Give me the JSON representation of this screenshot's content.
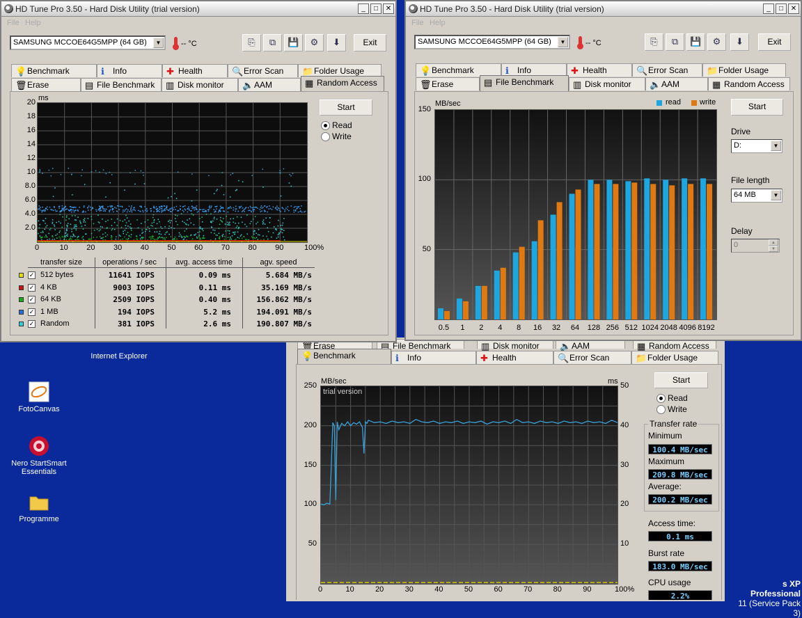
{
  "app_title": "HD Tune Pro 3.50 - Hard Disk Utility (trial version)",
  "menu": [
    "File",
    "Help"
  ],
  "drive": "SAMSUNG MCCOE64G5MPP (64 GB)",
  "temperature": "-- °C",
  "exit_label": "Exit",
  "start_label": "Start",
  "read_label": "Read",
  "write_label": "Write",
  "tabs_row1": [
    "Benchmark",
    "Info",
    "Health",
    "Error Scan",
    "Folder Usage"
  ],
  "tabs_row2": [
    "Erase",
    "File Benchmark",
    "Disk monitor",
    "AAM",
    "Random Access"
  ],
  "random_access": {
    "y_unit": "ms",
    "y_ticks": [
      "20",
      "18",
      "16",
      "14",
      "12",
      "10",
      "8.0",
      "6.0",
      "4.0",
      "2.0"
    ],
    "x_ticks": [
      "0",
      "10",
      "20",
      "30",
      "40",
      "50",
      "60",
      "70",
      "80",
      "90",
      "100%"
    ],
    "headers": [
      "transfer size",
      "operations / sec",
      "avg. access time",
      "agv. speed"
    ],
    "rows": [
      {
        "size": "512 bytes",
        "ops": "11641 IOPS",
        "time": "0.09 ms",
        "speed": "5.684 MB/s",
        "color": "#e8e000"
      },
      {
        "size": "4 KB",
        "ops": "9003 IOPS",
        "time": "0.11 ms",
        "speed": "35.169 MB/s",
        "color": "#cc1010"
      },
      {
        "size": "64 KB",
        "ops": "2509 IOPS",
        "time": "0.40 ms",
        "speed": "156.862 MB/s",
        "color": "#10b010"
      },
      {
        "size": "1 MB",
        "ops": "194 IOPS",
        "time": "5.2 ms",
        "speed": "194.091 MB/s",
        "color": "#2070e0"
      },
      {
        "size": "Random",
        "ops": "381 IOPS",
        "time": "2.6 ms",
        "speed": "190.807 MB/s",
        "color": "#30d0e0"
      }
    ]
  },
  "file_benchmark": {
    "y_unit": "MB/sec",
    "legend": {
      "read": "read",
      "write": "write"
    },
    "drive_label": "Drive",
    "drive_value": "D:",
    "file_length_label": "File length",
    "file_length_value": "64 MB",
    "delay_label": "Delay",
    "delay_value": "0"
  },
  "benchmark": {
    "y_unit_left": "MB/sec",
    "y_unit_right": "ms",
    "watermark": "trial version",
    "transfer_rate_label": "Transfer rate",
    "minimum_label": "Minimum",
    "minimum_value": "100.4 MB/sec",
    "maximum_label": "Maximum",
    "maximum_value": "209.8 MB/sec",
    "average_label": "Average:",
    "average_value": "200.2 MB/sec",
    "access_label": "Access time:",
    "access_value": "0.1 ms",
    "burst_label": "Burst rate",
    "burst_value": "183.0 MB/sec",
    "cpu_label": "CPU usage",
    "cpu_value": "2.2%"
  },
  "desktop_icons": [
    "Internet Explorer",
    "FotoCanvas",
    "Nero StartSmart Essentials",
    "Programme"
  ],
  "taskbar_text": [
    "s XP Professional",
    "11 (Service Pack 3)"
  ],
  "chart_data": [
    {
      "type": "bar",
      "categories": [
        "0.5",
        "1",
        "2",
        "4",
        "8",
        "16",
        "32",
        "64",
        "128",
        "256",
        "512",
        "1024",
        "2048",
        "4096",
        "8192"
      ],
      "ylabel": "MB/sec",
      "ylim": [
        0,
        150
      ],
      "y_ticks": [
        150,
        100,
        50
      ],
      "legend_placement": "top-right",
      "series": [
        {
          "name": "read",
          "color": "#1ea6e0",
          "values": [
            8,
            15,
            24,
            35,
            48,
            56,
            75,
            90,
            100,
            100,
            99,
            101,
            100,
            101,
            101
          ]
        },
        {
          "name": "write",
          "color": "#e07a10",
          "values": [
            6,
            13,
            24,
            37,
            52,
            71,
            84,
            93,
            97,
            97,
            98,
            97,
            96,
            97,
            97
          ]
        }
      ]
    },
    {
      "type": "line",
      "x_ticks": [
        "0",
        "10",
        "20",
        "30",
        "40",
        "50",
        "60",
        "70",
        "80",
        "90",
        "100%"
      ],
      "xlim": [
        0,
        100
      ],
      "ylabel": "MB/sec",
      "ylim": [
        0,
        250
      ],
      "y_ticks": [
        250,
        200,
        150,
        100,
        50
      ],
      "y2label": "ms",
      "y2lim": [
        0,
        50
      ],
      "y2_ticks": [
        50,
        40,
        30,
        20,
        10
      ],
      "series": [
        {
          "name": "Read",
          "color": "#3aa0d8",
          "x": [
            0,
            1,
            2,
            3,
            3.5,
            4,
            4.5,
            5,
            5.5,
            6,
            7,
            8,
            9,
            10,
            11,
            12,
            13,
            14,
            14.5,
            15,
            15.5,
            16,
            18,
            20,
            22,
            24,
            26,
            28,
            30,
            32,
            34,
            36,
            38,
            40,
            42,
            44,
            46,
            48,
            50,
            52,
            54,
            56,
            58,
            60,
            62,
            64,
            66,
            68,
            70,
            72,
            74,
            76,
            78,
            80,
            82,
            84,
            86,
            88,
            90,
            92,
            94,
            96,
            98,
            100
          ],
          "y": [
            101,
            100,
            102,
            101,
            150,
            204,
            200,
            106,
            205,
            195,
            203,
            200,
            205,
            200,
            204,
            202,
            205,
            198,
            165,
            205,
            203,
            207,
            204,
            205,
            203,
            206,
            204,
            205,
            203,
            208,
            205,
            204,
            206,
            203,
            205,
            204,
            206,
            203,
            205,
            204,
            206,
            202,
            205,
            204,
            206,
            203,
            208,
            204,
            205,
            203,
            206,
            204,
            205,
            203,
            206,
            204,
            205,
            203,
            206,
            204,
            205,
            203,
            207,
            204
          ]
        }
      ]
    }
  ]
}
